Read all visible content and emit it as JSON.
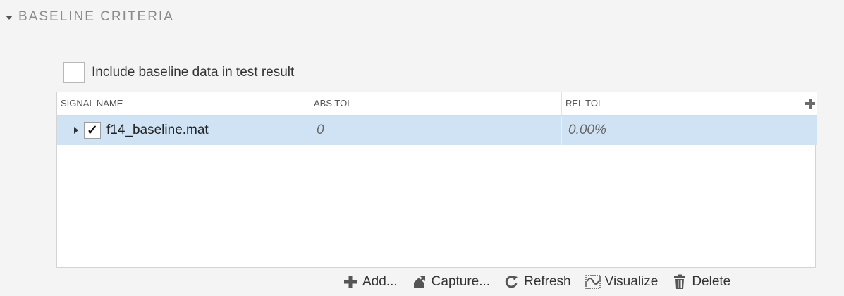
{
  "section": {
    "title": "BASELINE CRITERIA"
  },
  "include_option": {
    "label": "Include baseline data in test result",
    "checked": false
  },
  "table": {
    "columns": [
      "SIGNAL NAME",
      "ABS TOL",
      "REL TOL"
    ],
    "rows": [
      {
        "signal_name": "f14_baseline.mat",
        "checked": true,
        "abs_tol": "0",
        "rel_tol": "0.00%"
      }
    ]
  },
  "toolbar": {
    "add_label": "Add...",
    "capture_label": "Capture...",
    "refresh_label": "Refresh",
    "visualize_label": "Visualize",
    "delete_label": "Delete"
  },
  "colors": {
    "selected_row": "#cfe3f5",
    "header_text": "#8a8a8a"
  }
}
